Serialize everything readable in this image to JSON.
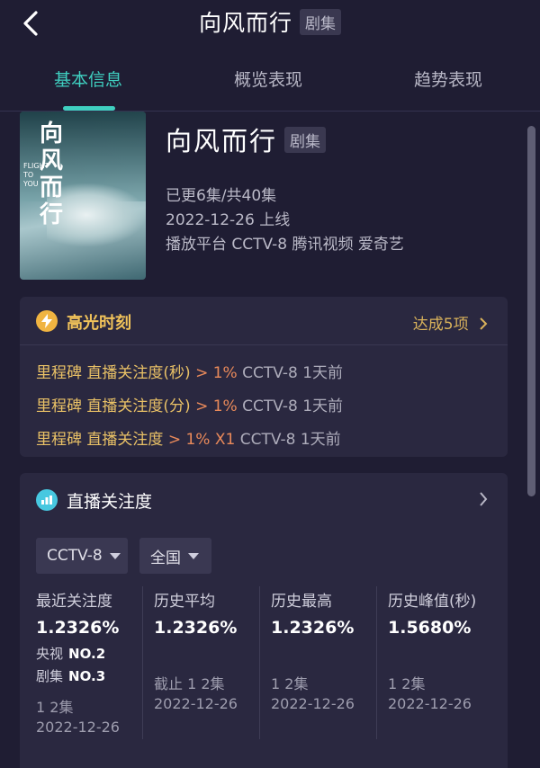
{
  "header": {
    "title": "向风而行",
    "tag": "剧集"
  },
  "tabs": [
    {
      "label": "基本信息",
      "active": true
    },
    {
      "label": "概览表现",
      "active": false
    },
    {
      "label": "趋势表现",
      "active": false
    }
  ],
  "show": {
    "name": "向风而行",
    "tag": "剧集",
    "episodes": "已更6集/共40集",
    "release": "2022-12-26 上线",
    "platforms": "播放平台 CCTV-8 腾讯视频 爱奇艺",
    "poster": {
      "title_text": "向风而行",
      "en_text": "FLIGHT TO YOU"
    }
  },
  "highlights": {
    "title": "高光时刻",
    "count": "达成5项",
    "rows": [
      {
        "label": "里程碑 直播关注度(秒)",
        "value": "> 1%",
        "meta": "CCTV-8 1天前"
      },
      {
        "label": "里程碑 直播关注度(分)",
        "value": "> 1%",
        "meta": "CCTV-8 1天前"
      },
      {
        "label": "里程碑 直播关注度",
        "value": "> 1% X1",
        "meta": "CCTV-8 1天前"
      }
    ]
  },
  "live_attention": {
    "title": "直播关注度",
    "channel_select": "CCTV-8",
    "region_select": "全国",
    "stats": [
      {
        "label": "最近关注度",
        "value": "1.2326%",
        "rank1_label": "央视",
        "rank1_value": "NO.2",
        "rank2_label": "剧集",
        "rank2_value": "NO.3",
        "episode": "1 2集",
        "date": "2022-12-26"
      },
      {
        "label": "历史平均",
        "value": "1.2326%",
        "episode": "截止 1 2集",
        "date": "2022-12-26"
      },
      {
        "label": "历史最高",
        "value": "1.2326%",
        "episode": "1 2集",
        "date": "2022-12-26"
      },
      {
        "label": "历史峰值(秒)",
        "value": "1.5680%",
        "episode": "1 2集",
        "date": "2022-12-26"
      }
    ]
  },
  "colors": {
    "accent": "#3fcfc0",
    "highlight": "#f0c25a",
    "orange": "#ea8a5a",
    "background": "#1f1d33",
    "card": "#2a2840"
  },
  "icons": {
    "back": "chevron-left-icon",
    "bolt": "lightning-icon",
    "chart": "chart-icon",
    "chevron": "chevron-right-icon",
    "dropdown": "caret-down-icon"
  }
}
